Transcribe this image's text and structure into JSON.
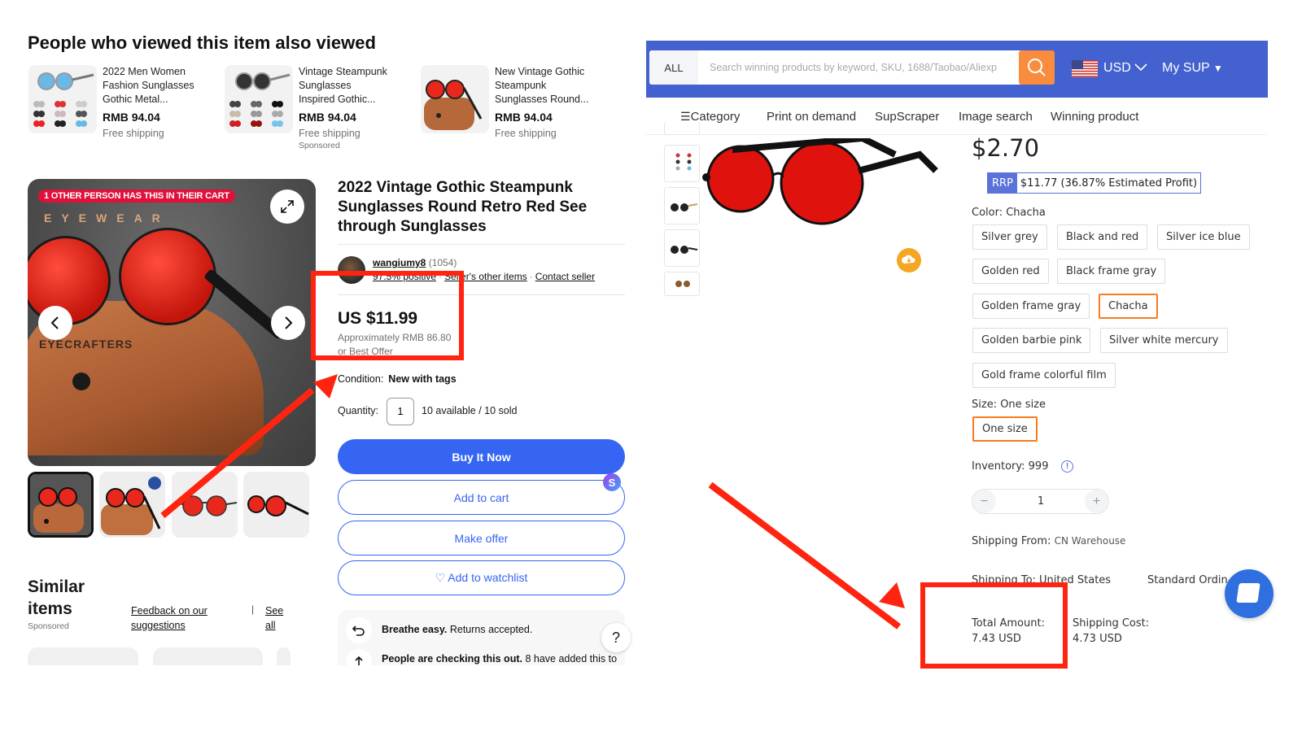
{
  "ebay": {
    "also_viewed": {
      "heading": "People who viewed this item also viewed",
      "items": [
        {
          "name_lines": [
            "2022 Men Women",
            "Fashion Sunglasses",
            "Gothic Metal..."
          ],
          "price": "RMB 94.04",
          "shipping": "Free shipping",
          "sponsored": ""
        },
        {
          "name_lines": [
            "Vintage Steampunk",
            "Sunglasses",
            "Inspired Gothic..."
          ],
          "price": "RMB 94.04",
          "shipping": "Free shipping",
          "sponsored": "Sponsored"
        },
        {
          "name_lines": [
            "New Vintage Gothic",
            "Steampunk",
            "Sunglasses Round..."
          ],
          "price": "RMB 94.04",
          "shipping": "Free shipping",
          "sponsored": ""
        }
      ]
    },
    "gallery": {
      "cart_badge": "1 OTHER PERSON HAS THIS IN THEIR CART",
      "brand_text": "EYEWEAR",
      "case_text": "EYECRAFTERS",
      "selected_thumb_index": 0,
      "thumb_count": 4
    },
    "similar": {
      "title": "Similar items",
      "sponsored": "Sponsored",
      "feedback_link": "Feedback on our suggestions",
      "separator": "|",
      "see_all": "See all"
    },
    "listing": {
      "title": "2022 Vintage Gothic Steampunk Sunglasses Round Retro Red See through Sunglasses",
      "seller": {
        "name": "wangiumy8",
        "feedback_count": "(1054)",
        "positive": "97.5% positive",
        "other_items": "Seller's other items",
        "contact": "Contact seller"
      },
      "price": "US $11.99",
      "approx": "Approximately RMB 86.80",
      "best_offer": "or Best Offer",
      "condition_label": "Condition:",
      "condition_value": "New with tags",
      "quantity_label": "Quantity:",
      "quantity_value": "1",
      "availability": "10 available / 10 sold",
      "buttons": {
        "buy_now": "Buy It Now",
        "add_to_cart": "Add to cart",
        "make_offer": "Make offer",
        "watchlist": "♡ Add to watchlist"
      },
      "extension_badge": "S",
      "info": [
        {
          "bold": "Breathe easy.",
          "text": " Returns accepted."
        },
        {
          "bold": "People are checking this out.",
          "text": " 8 have added this to"
        }
      ],
      "help": "?"
    }
  },
  "sup": {
    "search": {
      "scope": "ALL",
      "placeholder": "Search winning products by keyword, SKU, 1688/Taobao/Aliexp"
    },
    "currency": "USD",
    "account_menu": "My SUP",
    "nav": [
      "Category",
      "Print on demand",
      "SupScraper",
      "Image search",
      "Winning product"
    ],
    "product": {
      "price": "$2.70",
      "rrp_tag": "RRP",
      "rrp_value": "$11.77 (36.87% Estimated Profit)",
      "color_label": "Color: Chacha",
      "colors": [
        "Silver grey",
        "Black and red",
        "Silver ice blue",
        "Golden red",
        "Black frame gray",
        "Golden frame gray",
        "Chacha",
        "Golden barbie pink",
        "Silver white mercury",
        "Gold frame colorful film"
      ],
      "selected_color": "Chacha",
      "size_label": "Size: One size",
      "sizes": [
        "One size"
      ],
      "selected_size": "One size",
      "inventory": "Inventory: 999",
      "quantity": "1",
      "shipping_from_label": "Shipping From:",
      "shipping_from_value": "CN Warehouse",
      "shipping_to": "Shipping To: United States",
      "shipping_method": "Standard Ordinary",
      "total_label": "Total Amount:",
      "total_value": "7.43 USD",
      "shipping_cost_label": "Shipping Cost:",
      "shipping_cost_value": "4.73 USD"
    }
  },
  "annotation_color": "#ff2410"
}
